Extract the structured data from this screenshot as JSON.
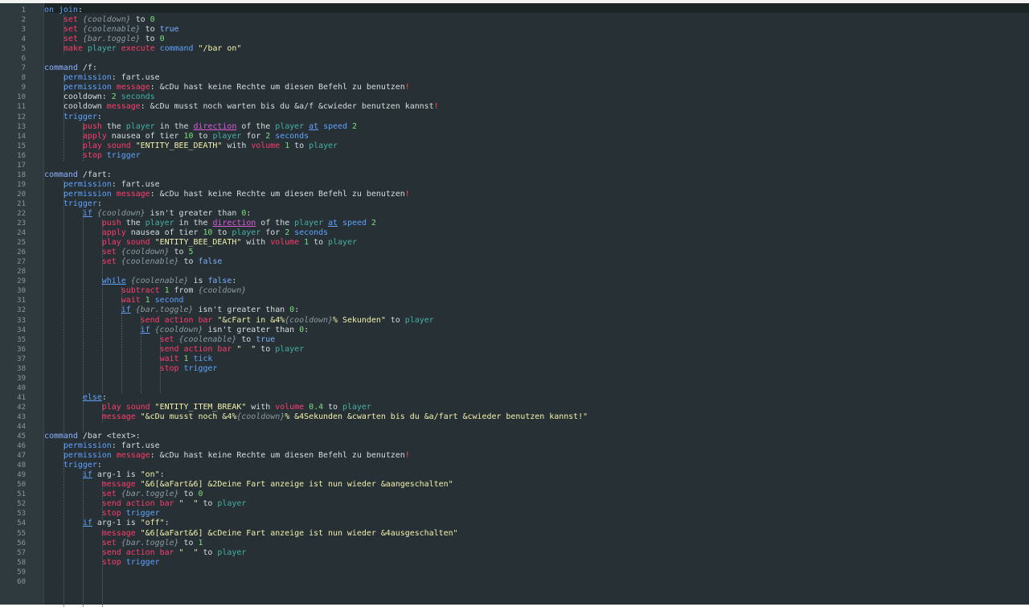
{
  "editor": {
    "lines": [
      [
        [
          "kw",
          "on join"
        ],
        [
          "txt",
          ":"
        ]
      ],
      [
        [
          "txt",
          "    "
        ],
        [
          "eff",
          "set"
        ],
        [
          "txt",
          " "
        ],
        [
          "var",
          "{cooldown}"
        ],
        [
          "txt",
          " to "
        ],
        [
          "num",
          "0"
        ]
      ],
      [
        [
          "txt",
          "    "
        ],
        [
          "eff",
          "set"
        ],
        [
          "txt",
          " "
        ],
        [
          "var",
          "{coolenable}"
        ],
        [
          "txt",
          " to "
        ],
        [
          "bool",
          "true"
        ]
      ],
      [
        [
          "txt",
          "    "
        ],
        [
          "eff",
          "set"
        ],
        [
          "txt",
          " "
        ],
        [
          "var",
          "{bar.toggle}"
        ],
        [
          "txt",
          " to "
        ],
        [
          "num",
          "0"
        ]
      ],
      [
        [
          "txt",
          "    "
        ],
        [
          "eff",
          "make"
        ],
        [
          "txt",
          " "
        ],
        [
          "pl",
          "player"
        ],
        [
          "txt",
          " "
        ],
        [
          "eff",
          "execute"
        ],
        [
          "txt",
          " "
        ],
        [
          "kw",
          "command"
        ],
        [
          "txt",
          " "
        ],
        [
          "str",
          "\"/bar on\""
        ]
      ],
      [],
      [
        [
          "cmd",
          "command"
        ],
        [
          "txt",
          " /f:"
        ]
      ],
      [
        [
          "txt",
          "    "
        ],
        [
          "kw",
          "permission"
        ],
        [
          "txt",
          ": fart.use"
        ]
      ],
      [
        [
          "txt",
          "    "
        ],
        [
          "kw",
          "permission"
        ],
        [
          "txt",
          " "
        ],
        [
          "eff",
          "message"
        ],
        [
          "txt",
          ": &cDu hast keine Rechte um diesen Befehl zu benutzen"
        ],
        [
          "excl",
          "!"
        ]
      ],
      [
        [
          "txt",
          "    cooldown: "
        ],
        [
          "num",
          "2"
        ],
        [
          "txt",
          " "
        ],
        [
          "pl",
          "seconds"
        ]
      ],
      [
        [
          "txt",
          "    cooldown "
        ],
        [
          "eff",
          "message"
        ],
        [
          "txt",
          ": &cDu musst noch warten bis du &a/f &cwieder benutzen kannst"
        ],
        [
          "excl",
          "!"
        ]
      ],
      [
        [
          "txt",
          "    "
        ],
        [
          "kw",
          "trigger"
        ],
        [
          "txt",
          ":"
        ]
      ],
      [
        [
          "txt",
          "        "
        ],
        [
          "eff",
          "push"
        ],
        [
          "txt",
          " the "
        ],
        [
          "pl",
          "player"
        ],
        [
          "txt",
          " in the "
        ],
        [
          "dir",
          "direction"
        ],
        [
          "txt",
          " of the "
        ],
        [
          "pl",
          "player"
        ],
        [
          "txt",
          " "
        ],
        [
          "under",
          "at"
        ],
        [
          "txt",
          " "
        ],
        [
          "kw",
          "speed"
        ],
        [
          "txt",
          " "
        ],
        [
          "num",
          "2"
        ]
      ],
      [
        [
          "txt",
          "        "
        ],
        [
          "eff",
          "apply"
        ],
        [
          "txt",
          " nausea of tier "
        ],
        [
          "num",
          "10"
        ],
        [
          "txt",
          " to "
        ],
        [
          "pl",
          "player"
        ],
        [
          "txt",
          " for "
        ],
        [
          "num",
          "2"
        ],
        [
          "txt",
          " "
        ],
        [
          "kw",
          "seconds"
        ]
      ],
      [
        [
          "txt",
          "        "
        ],
        [
          "eff",
          "play sound"
        ],
        [
          "txt",
          " "
        ],
        [
          "str",
          "\"ENTITY_BEE_DEATH\""
        ],
        [
          "txt",
          " with "
        ],
        [
          "eff",
          "volume"
        ],
        [
          "txt",
          " "
        ],
        [
          "num",
          "1"
        ],
        [
          "txt",
          " to "
        ],
        [
          "pl",
          "player"
        ]
      ],
      [
        [
          "txt",
          "        "
        ],
        [
          "eff",
          "stop"
        ],
        [
          "txt",
          " "
        ],
        [
          "kw",
          "trigger"
        ]
      ],
      [],
      [
        [
          "cmd",
          "command"
        ],
        [
          "txt",
          " /fart:"
        ]
      ],
      [
        [
          "txt",
          "    "
        ],
        [
          "kw",
          "permission"
        ],
        [
          "txt",
          ": fart.use"
        ]
      ],
      [
        [
          "txt",
          "    "
        ],
        [
          "kw",
          "permission"
        ],
        [
          "txt",
          " "
        ],
        [
          "eff",
          "message"
        ],
        [
          "txt",
          ": &cDu hast keine Rechte um diesen Befehl zu benutzen"
        ],
        [
          "excl",
          "!"
        ]
      ],
      [
        [
          "txt",
          "    "
        ],
        [
          "kw",
          "trigger"
        ],
        [
          "txt",
          ":"
        ]
      ],
      [
        [
          "txt",
          "        "
        ],
        [
          "under",
          "if"
        ],
        [
          "txt",
          " "
        ],
        [
          "var",
          "{cooldown}"
        ],
        [
          "txt",
          " isn't greater than "
        ],
        [
          "num",
          "0"
        ],
        [
          "txt",
          ":"
        ]
      ],
      [
        [
          "txt",
          "            "
        ],
        [
          "eff",
          "push"
        ],
        [
          "txt",
          " the "
        ],
        [
          "pl",
          "player"
        ],
        [
          "txt",
          " in the "
        ],
        [
          "dir",
          "direction"
        ],
        [
          "txt",
          " of the "
        ],
        [
          "pl",
          "player"
        ],
        [
          "txt",
          " "
        ],
        [
          "under",
          "at"
        ],
        [
          "txt",
          " "
        ],
        [
          "kw",
          "speed"
        ],
        [
          "txt",
          " "
        ],
        [
          "num",
          "2"
        ]
      ],
      [
        [
          "txt",
          "            "
        ],
        [
          "eff",
          "apply"
        ],
        [
          "txt",
          " nausea of tier "
        ],
        [
          "num",
          "10"
        ],
        [
          "txt",
          " to "
        ],
        [
          "pl",
          "player"
        ],
        [
          "txt",
          " for "
        ],
        [
          "num",
          "2"
        ],
        [
          "txt",
          " "
        ],
        [
          "kw",
          "seconds"
        ]
      ],
      [
        [
          "txt",
          "            "
        ],
        [
          "eff",
          "play sound"
        ],
        [
          "txt",
          " "
        ],
        [
          "str",
          "\"ENTITY_BEE_DEATH\""
        ],
        [
          "txt",
          " with "
        ],
        [
          "eff",
          "volume"
        ],
        [
          "txt",
          " "
        ],
        [
          "num",
          "1"
        ],
        [
          "txt",
          " to "
        ],
        [
          "pl",
          "player"
        ]
      ],
      [
        [
          "txt",
          "            "
        ],
        [
          "eff",
          "set"
        ],
        [
          "txt",
          " "
        ],
        [
          "var",
          "{cooldown}"
        ],
        [
          "txt",
          " to "
        ],
        [
          "num",
          "5"
        ]
      ],
      [
        [
          "txt",
          "            "
        ],
        [
          "eff",
          "set"
        ],
        [
          "txt",
          " "
        ],
        [
          "var",
          "{coolenable}"
        ],
        [
          "txt",
          " to "
        ],
        [
          "bool",
          "false"
        ]
      ],
      [],
      [
        [
          "txt",
          "            "
        ],
        [
          "under",
          "while"
        ],
        [
          "txt",
          " "
        ],
        [
          "var",
          "{coolenable}"
        ],
        [
          "txt",
          " is "
        ],
        [
          "bool",
          "false"
        ],
        [
          "txt",
          ":"
        ]
      ],
      [
        [
          "txt",
          "                "
        ],
        [
          "eff",
          "subtract"
        ],
        [
          "txt",
          " "
        ],
        [
          "num",
          "1"
        ],
        [
          "txt",
          " from "
        ],
        [
          "var",
          "{cooldown}"
        ]
      ],
      [
        [
          "txt",
          "                "
        ],
        [
          "eff",
          "wait"
        ],
        [
          "txt",
          " "
        ],
        [
          "num",
          "1"
        ],
        [
          "txt",
          " "
        ],
        [
          "kw",
          "second"
        ]
      ],
      [
        [
          "txt",
          "                "
        ],
        [
          "under",
          "if"
        ],
        [
          "txt",
          " "
        ],
        [
          "var",
          "{bar.toggle}"
        ],
        [
          "txt",
          " isn't greater than "
        ],
        [
          "num",
          "0"
        ],
        [
          "txt",
          ":"
        ]
      ],
      [
        [
          "txt",
          "                    "
        ],
        [
          "eff",
          "send action bar"
        ],
        [
          "txt",
          " "
        ],
        [
          "str",
          "\"&cFart in &4%"
        ],
        [
          "var",
          "{cooldown}"
        ],
        [
          "str",
          "% Sekunden\""
        ],
        [
          "txt",
          " to "
        ],
        [
          "pl",
          "player"
        ]
      ],
      [
        [
          "txt",
          "                    "
        ],
        [
          "under",
          "if"
        ],
        [
          "txt",
          " "
        ],
        [
          "var",
          "{cooldown}"
        ],
        [
          "txt",
          " isn't greater than "
        ],
        [
          "num",
          "0"
        ],
        [
          "txt",
          ":"
        ]
      ],
      [
        [
          "txt",
          "                        "
        ],
        [
          "eff",
          "set"
        ],
        [
          "txt",
          " "
        ],
        [
          "var",
          "{coolenable}"
        ],
        [
          "txt",
          " to "
        ],
        [
          "bool",
          "true"
        ]
      ],
      [
        [
          "txt",
          "                        "
        ],
        [
          "eff",
          "send action bar"
        ],
        [
          "txt",
          " "
        ],
        [
          "str",
          "\"  \""
        ],
        [
          "txt",
          " to "
        ],
        [
          "pl",
          "player"
        ]
      ],
      [
        [
          "txt",
          "                        "
        ],
        [
          "eff",
          "wait"
        ],
        [
          "txt",
          " "
        ],
        [
          "num",
          "1"
        ],
        [
          "txt",
          " "
        ],
        [
          "kw",
          "tick"
        ]
      ],
      [
        [
          "txt",
          "                        "
        ],
        [
          "eff",
          "stop"
        ],
        [
          "txt",
          " "
        ],
        [
          "kw",
          "trigger"
        ]
      ],
      [],
      [],
      [
        [
          "txt",
          "        "
        ],
        [
          "under",
          "else"
        ],
        [
          "txt",
          ":"
        ]
      ],
      [
        [
          "txt",
          "            "
        ],
        [
          "eff",
          "play sound"
        ],
        [
          "txt",
          " "
        ],
        [
          "str",
          "\"ENTITY_ITEM_BREAK\""
        ],
        [
          "txt",
          " with "
        ],
        [
          "eff",
          "volume"
        ],
        [
          "txt",
          " "
        ],
        [
          "num",
          "0.4"
        ],
        [
          "txt",
          " to "
        ],
        [
          "pl",
          "player"
        ]
      ],
      [
        [
          "txt",
          "            "
        ],
        [
          "eff",
          "message"
        ],
        [
          "txt",
          " "
        ],
        [
          "str",
          "\"&cDu musst noch &4%"
        ],
        [
          "var",
          "{cooldown}"
        ],
        [
          "str",
          "% &4Sekunden &cwarten bis du &a/fart &cwieder benutzen kannst!\""
        ]
      ],
      [],
      [
        [
          "cmd",
          "command"
        ],
        [
          "txt",
          " /bar <text>:"
        ]
      ],
      [
        [
          "txt",
          "    "
        ],
        [
          "kw",
          "permission"
        ],
        [
          "txt",
          ": fart.use"
        ]
      ],
      [
        [
          "txt",
          "    "
        ],
        [
          "kw",
          "permission"
        ],
        [
          "txt",
          " "
        ],
        [
          "eff",
          "message"
        ],
        [
          "txt",
          ": &cDu hast keine Rechte um diesen Befehl zu benutzen"
        ],
        [
          "excl",
          "!"
        ]
      ],
      [
        [
          "txt",
          "    "
        ],
        [
          "kw",
          "trigger"
        ],
        [
          "txt",
          ":"
        ]
      ],
      [
        [
          "txt",
          "        "
        ],
        [
          "under",
          "if"
        ],
        [
          "txt",
          " arg-1 is "
        ],
        [
          "str",
          "\"on\""
        ],
        [
          "txt",
          ":"
        ]
      ],
      [
        [
          "txt",
          "            "
        ],
        [
          "eff",
          "message"
        ],
        [
          "txt",
          " "
        ],
        [
          "str",
          "\"&6[&aFart&6] &2Deine Fart anzeige ist nun wieder &aangeschalten\""
        ]
      ],
      [
        [
          "txt",
          "            "
        ],
        [
          "eff",
          "set"
        ],
        [
          "txt",
          " "
        ],
        [
          "var",
          "{bar.toggle}"
        ],
        [
          "txt",
          " to "
        ],
        [
          "num",
          "0"
        ]
      ],
      [
        [
          "txt",
          "            "
        ],
        [
          "eff",
          "send action bar"
        ],
        [
          "txt",
          " "
        ],
        [
          "str",
          "\"  \""
        ],
        [
          "txt",
          " to "
        ],
        [
          "pl",
          "player"
        ]
      ],
      [
        [
          "txt",
          "            "
        ],
        [
          "eff",
          "stop"
        ],
        [
          "txt",
          " "
        ],
        [
          "kw",
          "trigger"
        ]
      ],
      [
        [
          "txt",
          "        "
        ],
        [
          "under",
          "if"
        ],
        [
          "txt",
          " arg-1 is "
        ],
        [
          "str",
          "\"off\""
        ],
        [
          "txt",
          ":"
        ]
      ],
      [
        [
          "txt",
          "            "
        ],
        [
          "eff",
          "message"
        ],
        [
          "txt",
          " "
        ],
        [
          "str",
          "\"&6[&aFart&6] &cDeine Fart anzeige ist nun wieder &4ausgeschalten\""
        ]
      ],
      [
        [
          "txt",
          "            "
        ],
        [
          "eff",
          "set"
        ],
        [
          "txt",
          " "
        ],
        [
          "var",
          "{bar.toggle}"
        ],
        [
          "txt",
          " to "
        ],
        [
          "num",
          "1"
        ]
      ],
      [
        [
          "txt",
          "            "
        ],
        [
          "eff",
          "send action bar"
        ],
        [
          "txt",
          " "
        ],
        [
          "str",
          "\"  \""
        ],
        [
          "txt",
          " to "
        ],
        [
          "pl",
          "player"
        ]
      ],
      [
        [
          "txt",
          "            "
        ],
        [
          "eff",
          "stop"
        ],
        [
          "txt",
          " "
        ],
        [
          "kw",
          "trigger"
        ]
      ],
      [],
      []
    ],
    "colors": {
      "background": "#273034",
      "gutter": "#2f3a3e",
      "keyword": "#5fa3ff",
      "effect": "#ff3b6e",
      "variable": "#8a9aa3",
      "string": "#f1f0aa",
      "number": "#7be07b",
      "player": "#46b0a6"
    }
  }
}
